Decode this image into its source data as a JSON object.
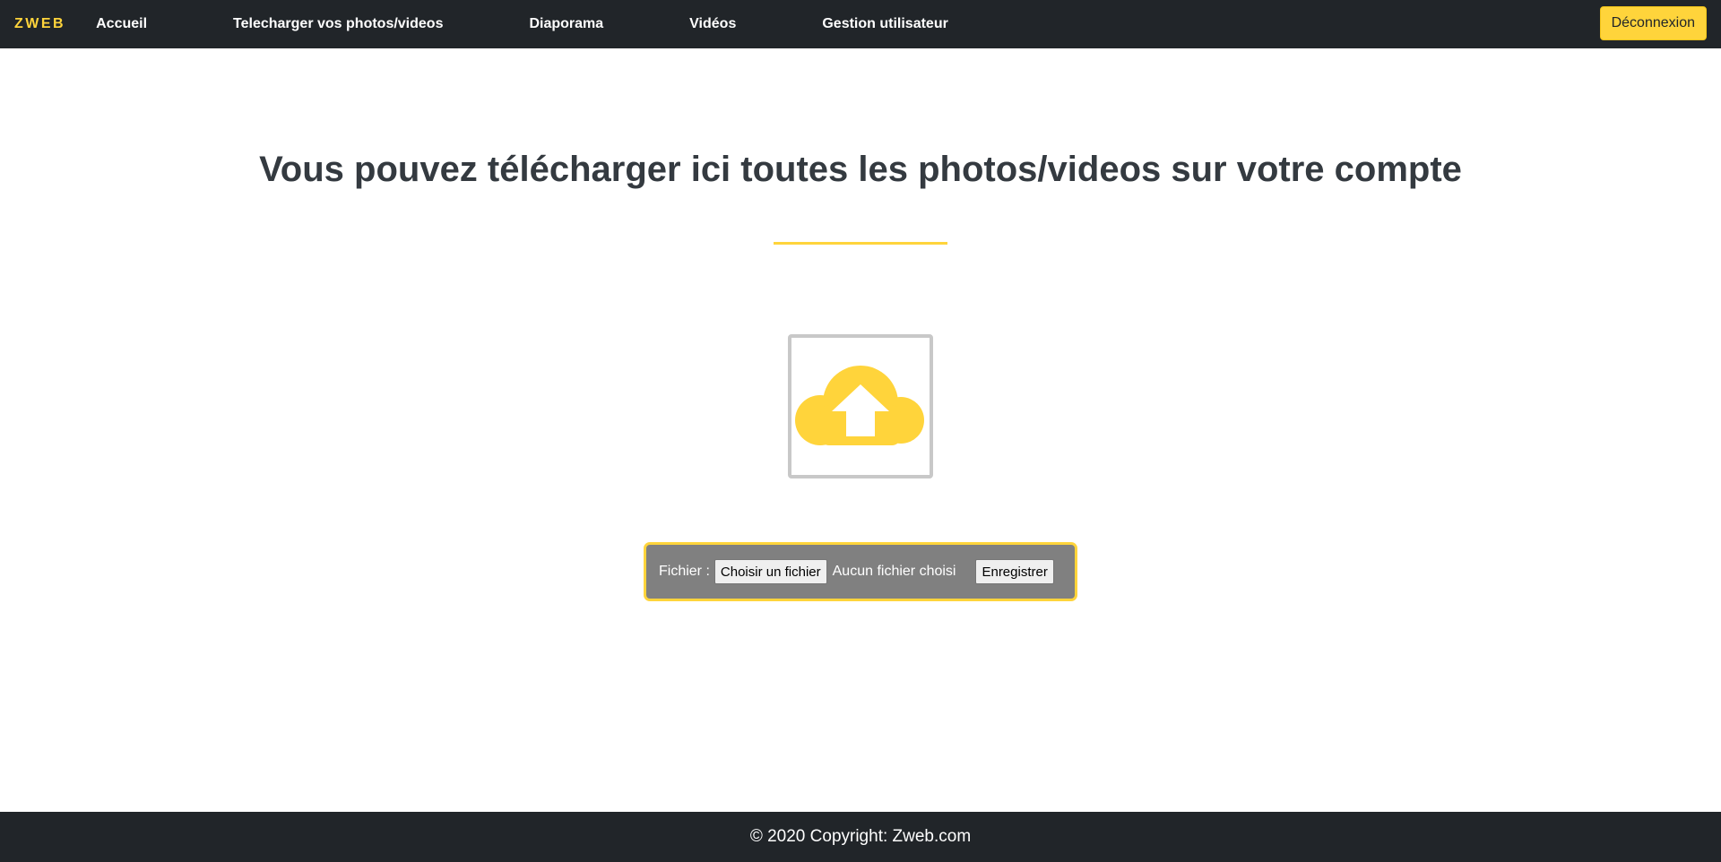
{
  "nav": {
    "brand": "ZWEB",
    "links": [
      {
        "label": "Accueil"
      },
      {
        "label": "Telecharger vos photos/videos"
      },
      {
        "label": "Diaporama"
      },
      {
        "label": "Vidéos"
      },
      {
        "label": "Gestion utilisateur"
      }
    ],
    "logout_label": "Déconnexion"
  },
  "main": {
    "title": "Vous pouvez télécharger ici toutes les photos/videos sur votre compte",
    "upload_icon": "cloud-upload-icon",
    "form": {
      "file_label": "Fichier :",
      "choose_button": "Choisir un fichier",
      "file_status": "Aucun fichier choisi",
      "submit_button": "Enregistrer"
    }
  },
  "footer": {
    "text": "© 2020 Copyright: Zweb.com"
  },
  "colors": {
    "accent": "#ffd43b",
    "dark": "#212529",
    "form_bg": "#808080"
  }
}
